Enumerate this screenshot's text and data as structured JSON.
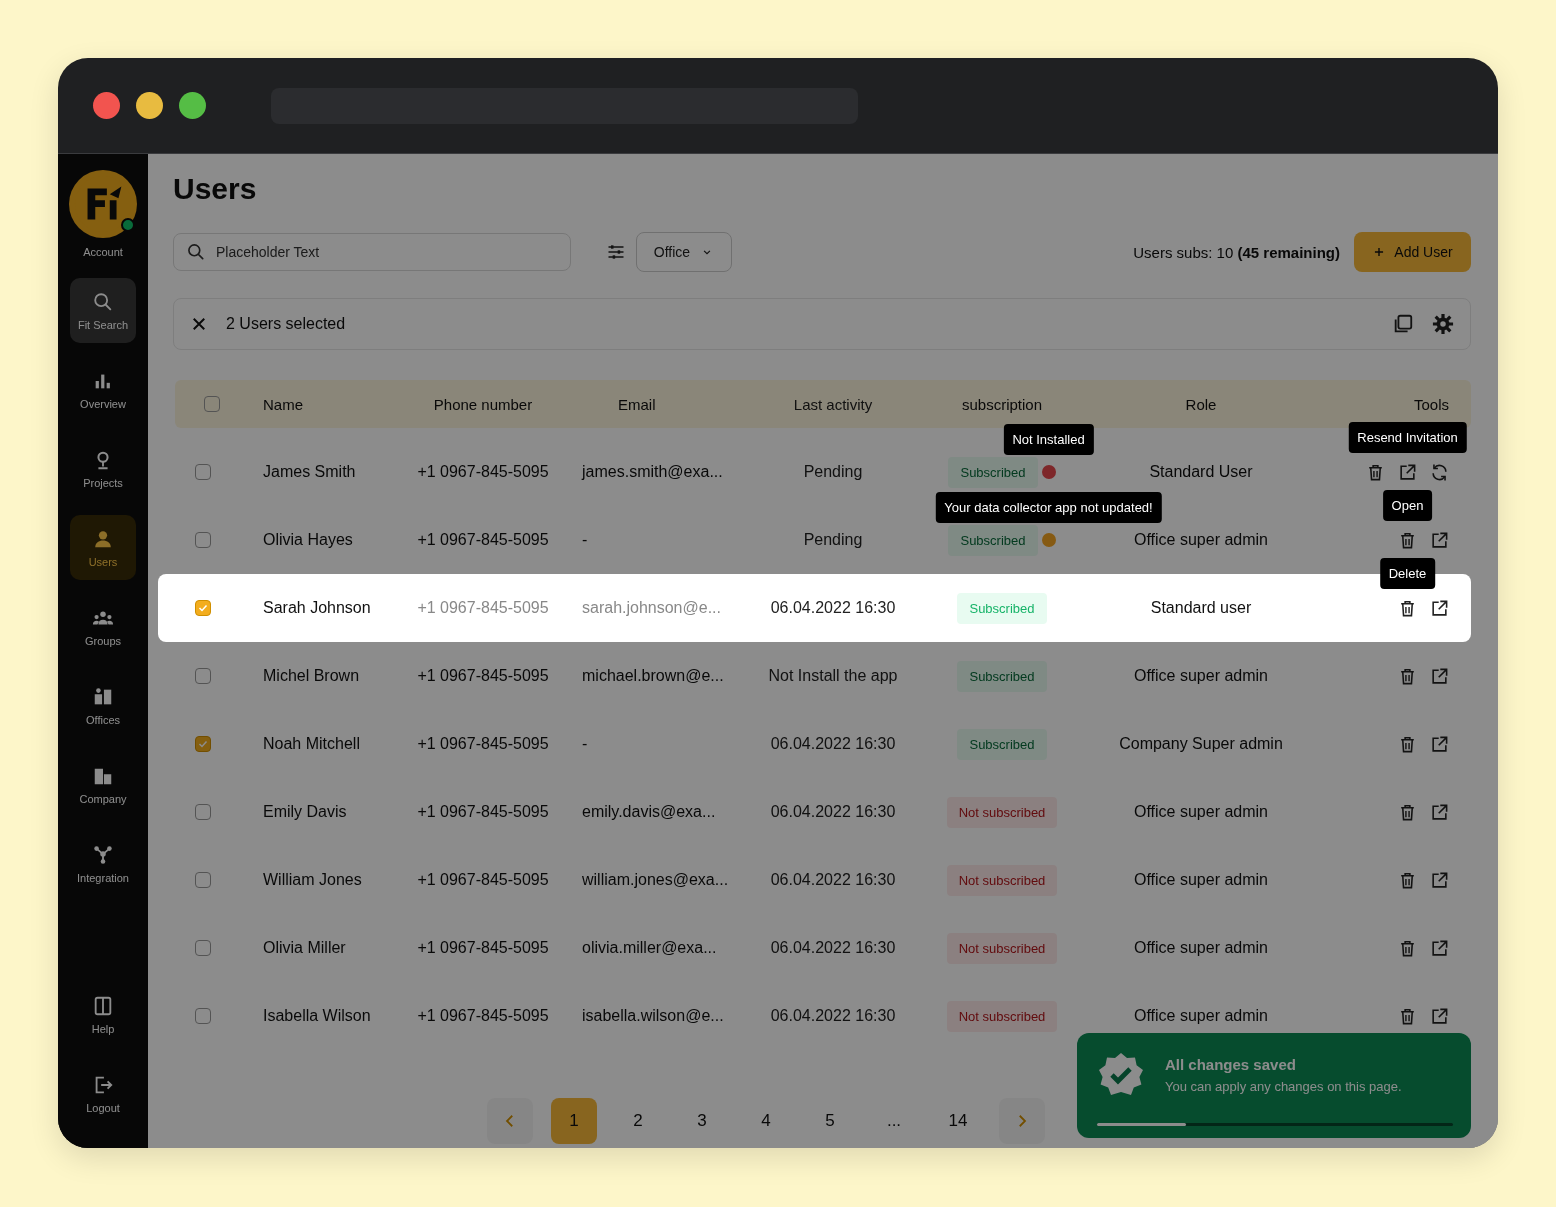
{
  "sidebar": {
    "account": "Account",
    "items": [
      {
        "kind": "search",
        "label": "Fit Search",
        "selected": false,
        "hovered": true
      },
      {
        "kind": "chart",
        "label": "Overview",
        "selected": false,
        "hovered": false
      },
      {
        "kind": "pin",
        "label": "Projects",
        "selected": false,
        "hovered": false
      },
      {
        "kind": "user",
        "label": "Users",
        "selected": true,
        "hovered": false
      },
      {
        "kind": "group",
        "label": "Groups",
        "selected": false,
        "hovered": false
      },
      {
        "kind": "office",
        "label": "Offices",
        "selected": false,
        "hovered": false
      },
      {
        "kind": "building",
        "label": "Company",
        "selected": false,
        "hovered": false
      },
      {
        "kind": "nodes",
        "label": "Integration",
        "selected": false,
        "hovered": false
      }
    ],
    "bottom_items": [
      {
        "kind": "help",
        "label": "Help"
      },
      {
        "kind": "logout",
        "label": "Logout"
      }
    ]
  },
  "page": {
    "title": "Users",
    "search": {
      "placeholder": "Placeholder Text"
    },
    "filter": {
      "value": "Office"
    },
    "subs": "Users subs: 10 **(45 remaining)**",
    "add_button": "Add User"
  },
  "selection_bar": {
    "text": "2 Users selected"
  },
  "table": {
    "columns": [
      "Name",
      "Phone number",
      "Email",
      "Last activity",
      "subscription",
      "Role",
      "Tools"
    ],
    "select_all": {
      "checked": false
    },
    "rows": [
      {
        "checked": false,
        "highlighted": false,
        "name": "James Smith",
        "phone": "+1 0967-845-5095",
        "email": "james.smith@exa...",
        "activity": "Pending",
        "subscription": {
          "kind": "subscribed",
          "label": "Subscribed",
          "dot": {
            "kind": "error",
            "tooltip": "Not Installed"
          }
        },
        "role": "Standard User",
        "resend": true,
        "tool_tooltip": {
          "kind": "open",
          "text": "Resend Invitation"
        }
      },
      {
        "checked": false,
        "highlighted": false,
        "name": "Olivia Hayes",
        "phone": "+1 0967-845-5095",
        "email": "-",
        "activity": "Pending",
        "subscription": {
          "kind": "subscribed",
          "label": "Subscribed",
          "dot": {
            "kind": "warning",
            "tooltip": "Your data collector app not updated!"
          }
        },
        "role": "Office super admin",
        "resend": false,
        "tool_tooltip": {
          "kind": "delete",
          "text": "Open"
        }
      },
      {
        "checked": true,
        "highlighted": true,
        "name": "Sarah Johnson",
        "phone": "+1 0967-845-5095",
        "email": "sarah.johnson@e...",
        "activity": "06.04.2022 16:30",
        "subscription": {
          "kind": "subscribed",
          "label": "Subscribed"
        },
        "role": "Standard user",
        "resend": false,
        "tool_tooltip": {
          "kind": "delete",
          "text": "Delete"
        }
      },
      {
        "checked": false,
        "highlighted": false,
        "name": "Michel Brown",
        "phone": "+1 0967-845-5095",
        "email": "michael.brown@e...",
        "activity": "Not Install the app",
        "subscription": {
          "kind": "subscribed",
          "label": "Subscribed"
        },
        "role": "Office super admin",
        "resend": false
      },
      {
        "checked": true,
        "highlighted": false,
        "name": "Noah Mitchell",
        "phone": "+1 0967-845-5095",
        "email": "-",
        "activity": "06.04.2022 16:30",
        "subscription": {
          "kind": "subscribed",
          "label": "Subscribed"
        },
        "role": "Company Super admin",
        "resend": false
      },
      {
        "checked": false,
        "highlighted": false,
        "name": "Emily Davis",
        "phone": "+1 0967-845-5095",
        "email": "emily.davis@exa...",
        "activity": "06.04.2022 16:30",
        "subscription": {
          "kind": "not_subscribed",
          "label": "Not subscribed"
        },
        "role": "Office super admin",
        "resend": false
      },
      {
        "checked": false,
        "highlighted": false,
        "name": "William Jones",
        "phone": "+1 0967-845-5095",
        "email": "william.jones@exa...",
        "activity": "06.04.2022 16:30",
        "subscription": {
          "kind": "not_subscribed",
          "label": "Not subscribed"
        },
        "role": "Office super admin",
        "resend": false
      },
      {
        "checked": false,
        "highlighted": false,
        "name": "Olivia Miller",
        "phone": "+1 0967-845-5095",
        "email": "olivia.miller@exa...",
        "activity": "06.04.2022 16:30",
        "subscription": {
          "kind": "not_subscribed",
          "label": "Not subscribed"
        },
        "role": "Office super admin",
        "resend": false
      },
      {
        "checked": false,
        "highlighted": false,
        "name": "Isabella Wilson",
        "phone": "+1 0967-845-5095",
        "email": "isabella.wilson@e...",
        "activity": "06.04.2022 16:30",
        "subscription": {
          "kind": "not_subscribed",
          "label": "Not subscribed"
        },
        "role": "Office super admin",
        "resend": false
      }
    ]
  },
  "pagination": {
    "pages": [
      {
        "label": "1",
        "selected": true
      },
      {
        "label": "2",
        "selected": false
      },
      {
        "label": "3",
        "selected": false
      },
      {
        "label": "4",
        "selected": false
      },
      {
        "label": "5",
        "selected": false
      },
      {
        "label": "...",
        "selected": false
      },
      {
        "label": "14",
        "selected": false
      }
    ]
  },
  "toast": {
    "title": "All changes saved",
    "message": "You can apply any changes on this page.",
    "level": 0.25
  }
}
